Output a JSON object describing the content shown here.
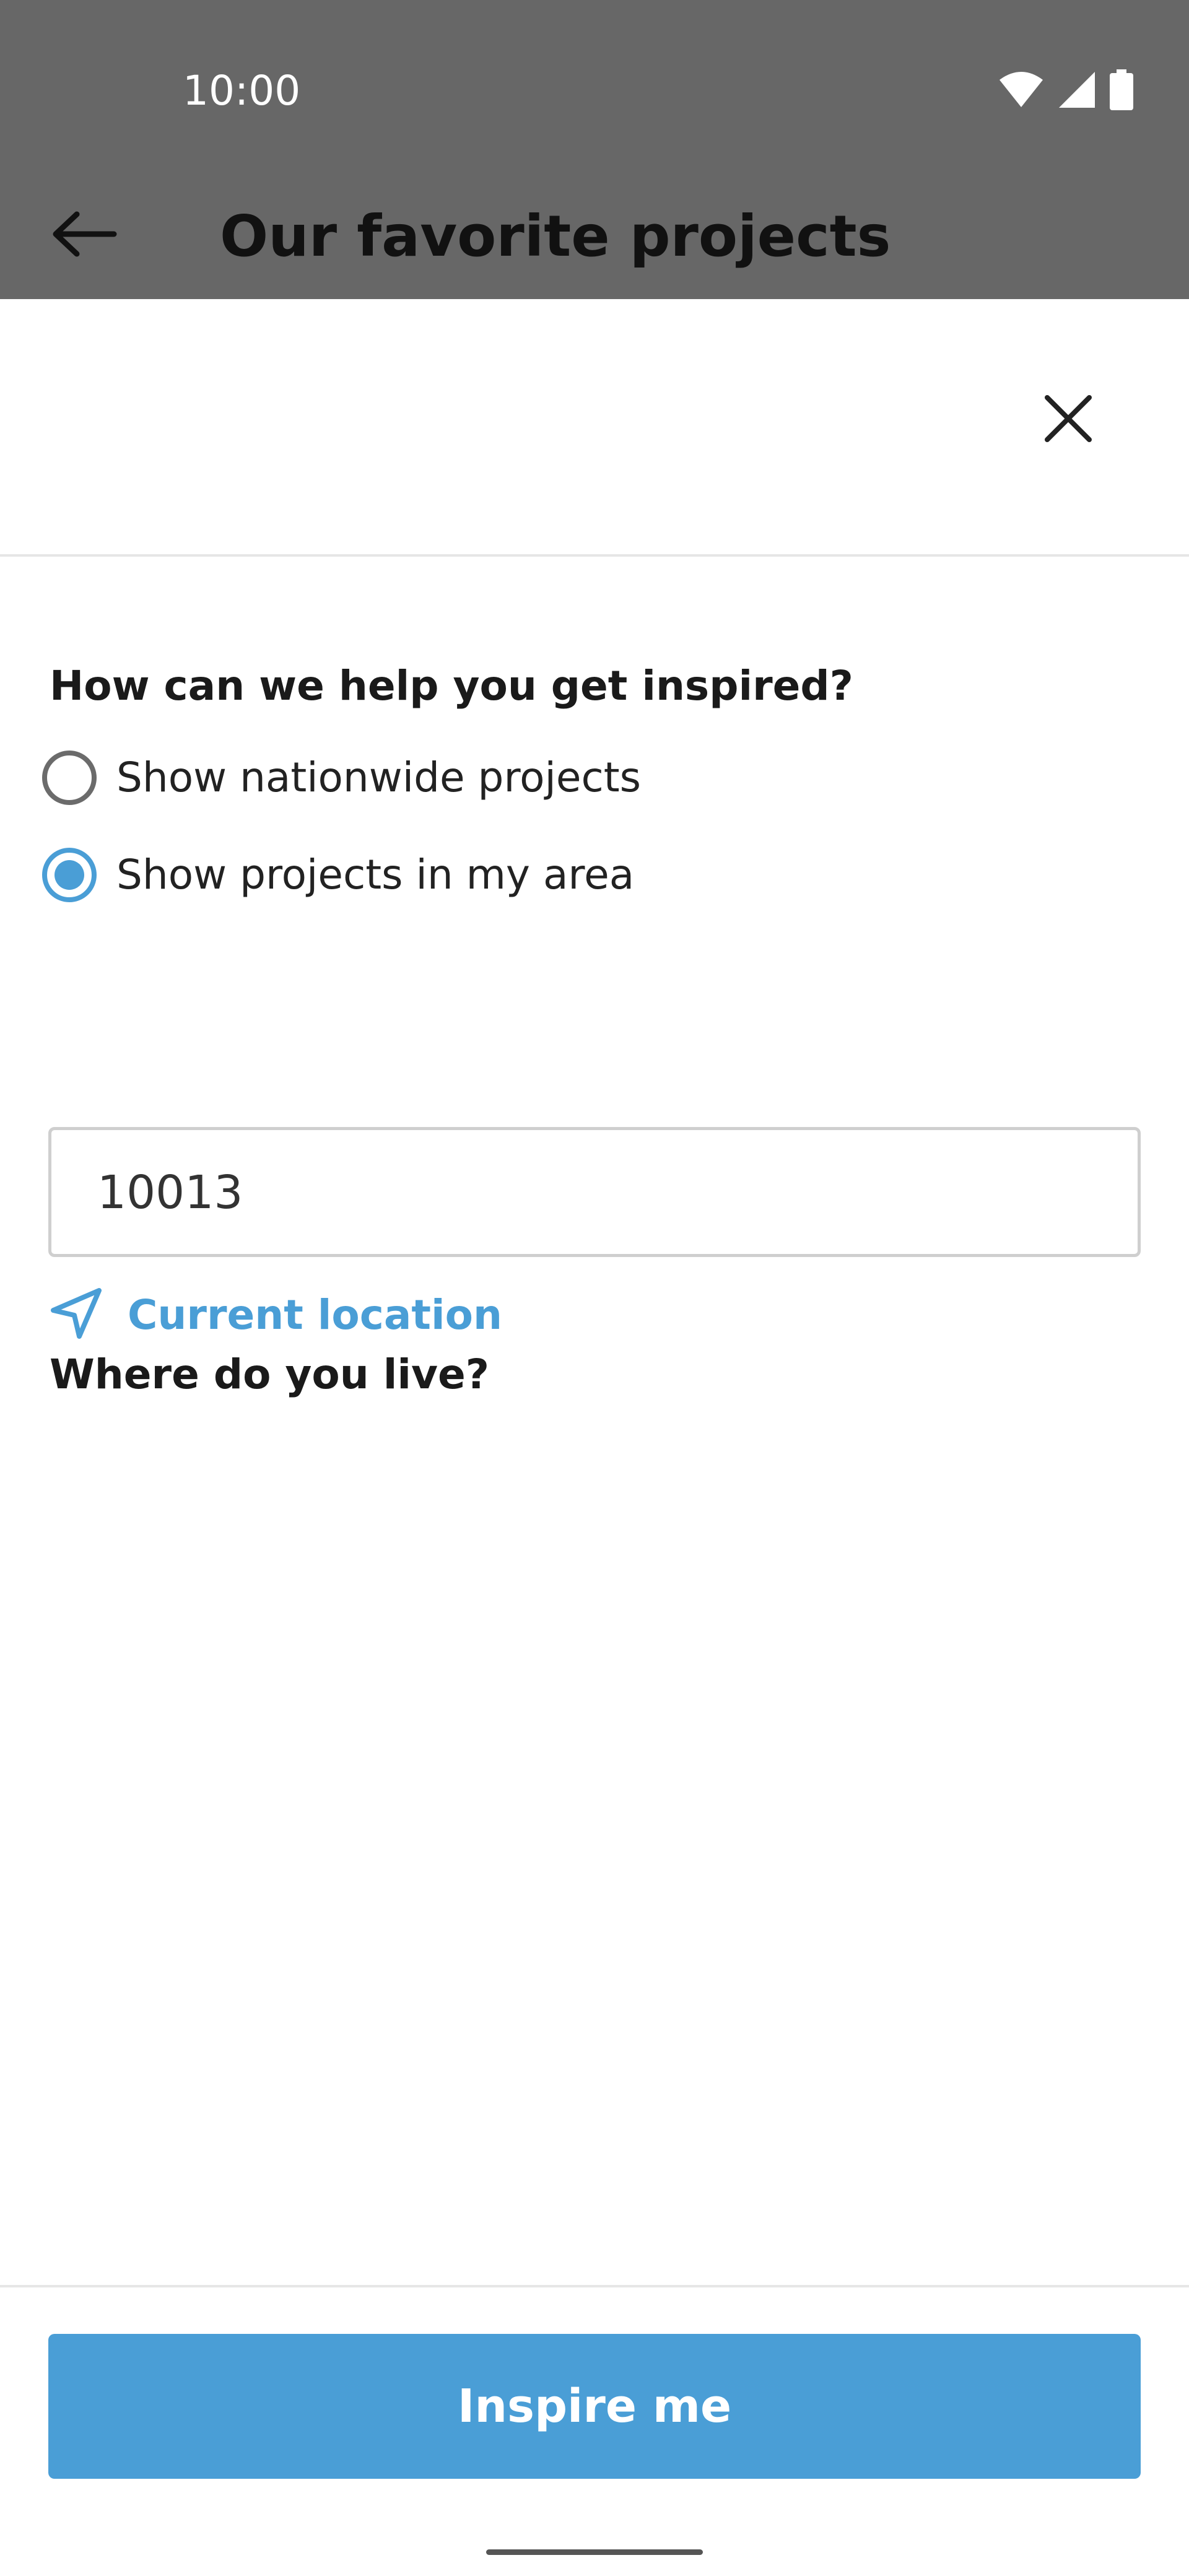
{
  "status_bar": {
    "time": "10:00",
    "icons": [
      "wifi-icon",
      "cellular-signal-icon",
      "battery-icon"
    ]
  },
  "app_bar": {
    "back_icon": "arrow-left-icon",
    "title": "Our favorite projects"
  },
  "sheet": {
    "close_icon": "close-icon",
    "question": "How can we help you get inspired?",
    "options": [
      {
        "label": "Show nationwide projects",
        "selected": false
      },
      {
        "label": "Show projects in my area",
        "selected": true
      }
    ],
    "location_heading": "Where do you live?",
    "zip_value": "10013",
    "current_location_label": "Current location",
    "location_icon": "navigation-arrow-icon",
    "cta_label": "Inspire me"
  },
  "colors": {
    "accent": "#4a9ed6",
    "scrim": "#676767",
    "text_dark": "#1a1a1a"
  }
}
